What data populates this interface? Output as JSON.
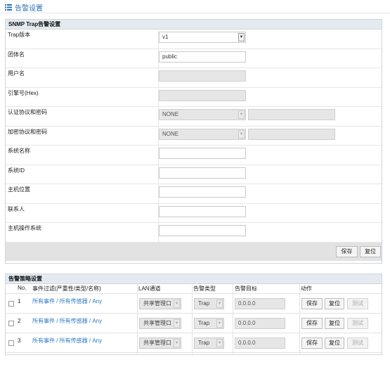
{
  "page": {
    "title": "告警设置",
    "title_icon": "list-icon",
    "accent": "#2a6fb5"
  },
  "snmp": {
    "header": "SNMP Trap告警设置",
    "rows": [
      {
        "label": "Trap版本",
        "value": "v1"
      },
      {
        "label": "团体名",
        "value": "public"
      },
      {
        "label": "用户名",
        "value": ""
      },
      {
        "label": "引擎号(Hex)",
        "value": ""
      },
      {
        "label": "认证协议和密码",
        "value": "NONE"
      },
      {
        "label": "加密协议和密码",
        "value": "NONE"
      },
      {
        "label": "系统名称",
        "value": ""
      },
      {
        "label": "系统ID",
        "value": ""
      },
      {
        "label": "主机位置",
        "value": ""
      },
      {
        "label": "联系人",
        "value": ""
      },
      {
        "label": "主机操作系统",
        "value": ""
      }
    ],
    "save_label": "保存",
    "reset_label": "复位"
  },
  "policy": {
    "header": "告警策略设置",
    "columns": [
      "No.",
      "事件过滤(严重性/类型/名称)",
      "LAN通道",
      "告警类型",
      "告警目标",
      "动作"
    ],
    "rows": [
      {
        "no": "1",
        "filter": "所有事件 / 所有传感器 / Any",
        "lan": "共享管理口",
        "type": "Trap",
        "target": "0.0.0.0"
      },
      {
        "no": "2",
        "filter": "所有事件 / 所有传感器 / Any",
        "lan": "共享管理口",
        "type": "Trap",
        "target": "0.0.0.0"
      },
      {
        "no": "3",
        "filter": "所有事件 / 所有传感器 / Any",
        "lan": "共享管理口",
        "type": "Trap",
        "target": "0.0.0.0"
      }
    ],
    "actions": {
      "save": "保存",
      "reset": "复位",
      "test": "测试"
    }
  }
}
